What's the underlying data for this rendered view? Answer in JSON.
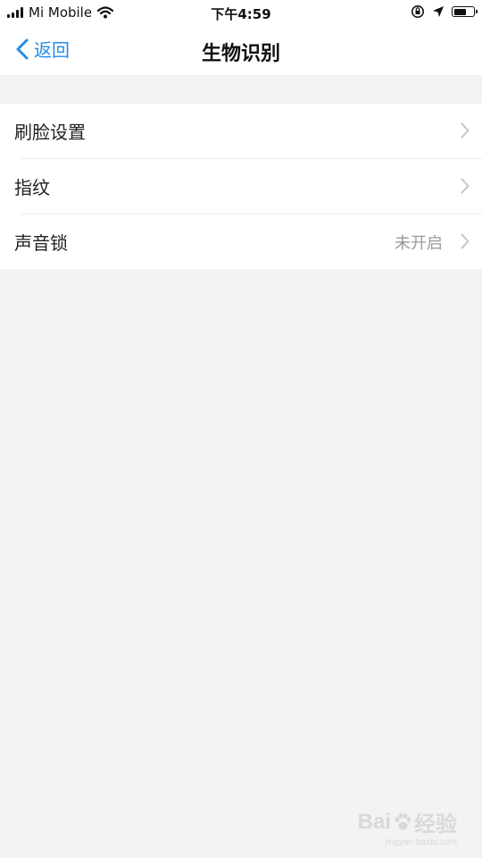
{
  "status_bar": {
    "carrier": "Mi Mobile",
    "time": "下午4:59",
    "icons": [
      "signal-icon",
      "wifi-icon",
      "orientation-lock-icon",
      "location-icon",
      "battery-icon"
    ],
    "battery_level": 0.65
  },
  "nav": {
    "back_label": "返回",
    "title": "生物识别"
  },
  "list": {
    "items": [
      {
        "label": "刷脸设置",
        "value": ""
      },
      {
        "label": "指纹",
        "value": ""
      },
      {
        "label": "声音锁",
        "value": "未开启"
      }
    ]
  },
  "watermark": {
    "main_left": "Bai",
    "main_right": "经验",
    "sub": "jingyan.baidu.com"
  },
  "colors": {
    "accent": "#1f8ceb",
    "background": "#f3f3f3",
    "secondary_text": "#9a9a9a"
  }
}
